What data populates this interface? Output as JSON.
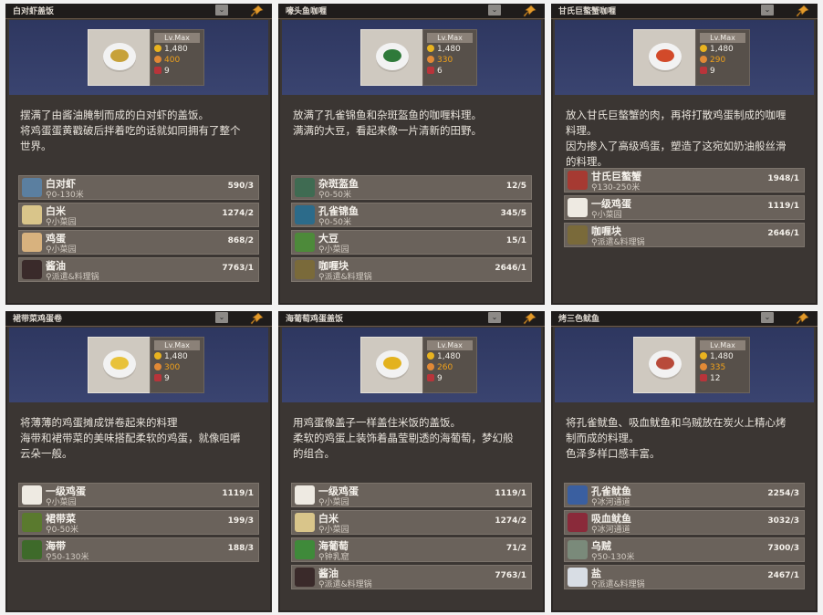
{
  "cards": [
    {
      "title": "白对虾盖饭",
      "lv": "Lv.Max",
      "price": "1,480",
      "taste": "400",
      "count": "9",
      "food_color": "#c7a23a",
      "desc": [
        "摆满了由酱油腌制而成的白对虾的盖饭。",
        "将鸡蛋蛋黄戳破后拌着吃的话就如同拥有了整个",
        "世界。"
      ],
      "ingredients": [
        {
          "name": "白对虾",
          "loc": "0-130米",
          "count": "590/3",
          "icon": "shrimp-icon",
          "color": "#5b7fa0"
        },
        {
          "name": "白米",
          "loc": "小菜园",
          "count": "1274/2",
          "icon": "rice-bag-icon",
          "color": "#d9c58a"
        },
        {
          "name": "鸡蛋",
          "loc": "小菜园",
          "count": "868/2",
          "icon": "egg-icon",
          "color": "#d8b27e"
        },
        {
          "name": "酱油",
          "loc": "派遣&料理锅",
          "count": "7763/1",
          "icon": "soy-sauce-icon",
          "color": "#3a2a2a"
        }
      ]
    },
    {
      "title": "嚎头鱼咖喱",
      "lv": "Lv.Max",
      "price": "1,480",
      "taste": "330",
      "count": "6",
      "food_color": "#2f7a3a",
      "desc": [
        "放满了孔雀锦鱼和杂斑盔鱼的咖喱料理。",
        "满满的大豆，看起来像一片清新的田野。"
      ],
      "ingredients": [
        {
          "name": "杂斑盔鱼",
          "loc": "0-50米",
          "count": "12/5",
          "icon": "fish-icon",
          "color": "#3f6b52"
        },
        {
          "name": "孔雀锦鱼",
          "loc": "0-50米",
          "count": "345/5",
          "icon": "fish-icon",
          "color": "#2c6b8a"
        },
        {
          "name": "大豆",
          "loc": "小菜园",
          "count": "15/1",
          "icon": "soybean-icon",
          "color": "#4d8a3a"
        },
        {
          "name": "咖喱块",
          "loc": "派遣&料理锅",
          "count": "2646/1",
          "icon": "curry-block-icon",
          "color": "#7a6a3a"
        }
      ]
    },
    {
      "title": "甘氏巨螯蟹咖喱",
      "lv": "Lv.Max",
      "price": "1,480",
      "taste": "290",
      "count": "9",
      "food_color": "#d24a2a",
      "desc": [
        "放入甘氏巨螯蟹的肉，再将打散鸡蛋制成的咖喱",
        "料理。",
        "因为掺入了高级鸡蛋，塑造了这宛如奶油般丝滑",
        "的料理。"
      ],
      "ingredients": [
        {
          "name": "甘氏巨螯蟹",
          "loc": "130-250米",
          "count": "1948/1",
          "icon": "crab-icon",
          "color": "#a63a32"
        },
        {
          "name": "一级鸡蛋",
          "loc": "小菜园",
          "count": "1119/1",
          "icon": "egg-icon",
          "color": "#eeeae2"
        },
        {
          "name": "咖喱块",
          "loc": "派遣&料理锅",
          "count": "2646/1",
          "icon": "curry-block-icon",
          "color": "#7a6a3a"
        }
      ]
    },
    {
      "title": "裙带菜鸡蛋卷",
      "lv": "Lv.Max",
      "price": "1,480",
      "taste": "300",
      "count": "9",
      "food_color": "#e8c23a",
      "desc": [
        "将薄薄的鸡蛋摊成饼卷起来的料理",
        "海带和裙带菜的美味搭配柔软的鸡蛋，就像咀嚼",
        "云朵一般。"
      ],
      "ingredients": [
        {
          "name": "一级鸡蛋",
          "loc": "小菜园",
          "count": "1119/1",
          "icon": "egg-icon",
          "color": "#eeeae2"
        },
        {
          "name": "裙带菜",
          "loc": "0-50米",
          "count": "199/3",
          "icon": "seaweed-icon",
          "color": "#5a7a2e"
        },
        {
          "name": "海带",
          "loc": "50-130米",
          "count": "188/3",
          "icon": "kelp-icon",
          "color": "#3e6a2a"
        }
      ]
    },
    {
      "title": "海葡萄鸡蛋盖饭",
      "lv": "Lv.Max",
      "price": "1,480",
      "taste": "260",
      "count": "9",
      "food_color": "#e3b21e",
      "desc": [
        "用鸡蛋像盖子一样盖住米饭的盖饭。",
        "柔软的鸡蛋上装饰着晶莹剔透的海葡萄，梦幻般",
        "的组合。"
      ],
      "ingredients": [
        {
          "name": "一级鸡蛋",
          "loc": "小菜园",
          "count": "1119/1",
          "icon": "egg-icon",
          "color": "#eeeae2"
        },
        {
          "name": "白米",
          "loc": "小菜园",
          "count": "1274/2",
          "icon": "rice-bag-icon",
          "color": "#d9c58a"
        },
        {
          "name": "海葡萄",
          "loc": "钟乳窟",
          "count": "71/2",
          "icon": "sea-grape-icon",
          "color": "#3f8a3a"
        },
        {
          "name": "酱油",
          "loc": "派遣&料理锅",
          "count": "7763/1",
          "icon": "soy-sauce-icon",
          "color": "#3a2a2a"
        }
      ]
    },
    {
      "title": "烤三色鱿鱼",
      "lv": "Lv.Max",
      "price": "1,480",
      "taste": "335",
      "count": "12",
      "food_color": "#b84a3a",
      "desc": [
        "将孔雀鱿鱼、吸血鱿鱼和乌贼放在炭火上精心烤",
        "制而成的料理。",
        "色泽多样口感丰富。"
      ],
      "ingredients": [
        {
          "name": "孔雀鱿鱼",
          "loc": "冰河通道",
          "count": "2254/3",
          "icon": "squid-icon",
          "color": "#3a5fa0"
        },
        {
          "name": "吸血鱿鱼",
          "loc": "冰河通道",
          "count": "3032/3",
          "icon": "squid-icon",
          "color": "#8a2a3a"
        },
        {
          "name": "乌贼",
          "loc": "50-130米",
          "count": "7300/3",
          "icon": "cuttlefish-icon",
          "color": "#7a8a7a"
        },
        {
          "name": "盐",
          "loc": "派遣&料理锅",
          "count": "2467/1",
          "icon": "salt-icon",
          "color": "#d8dde4"
        }
      ]
    }
  ]
}
